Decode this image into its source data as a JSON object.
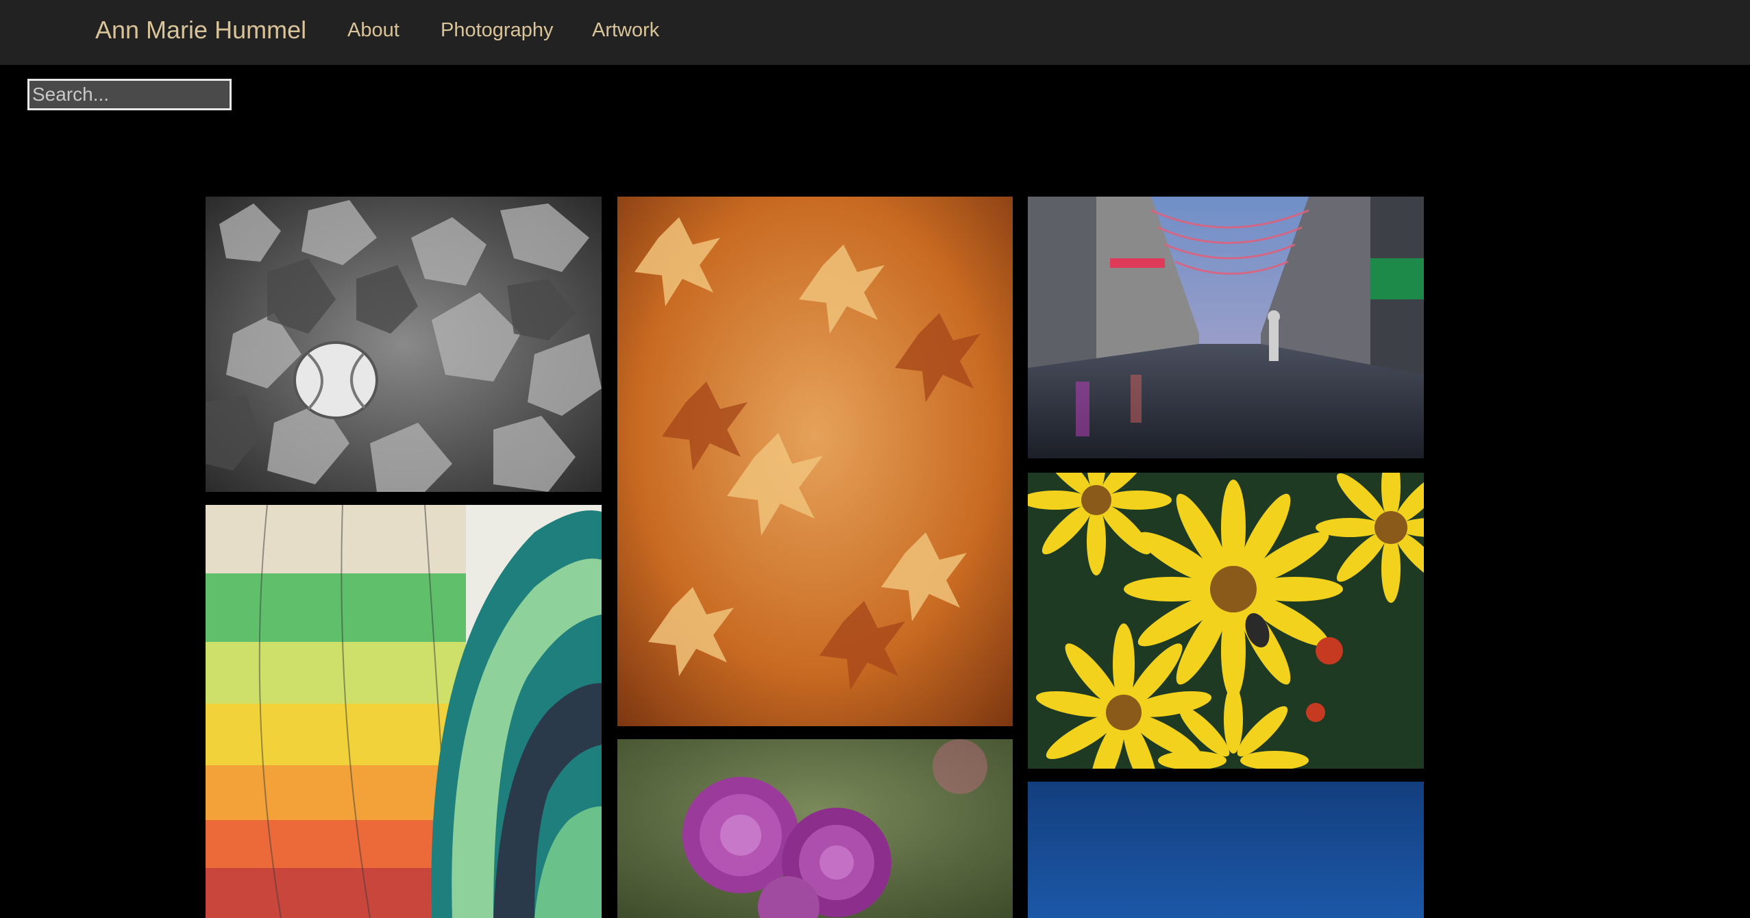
{
  "header": {
    "brand": "Ann Marie Hummel",
    "nav": [
      {
        "label": "About"
      },
      {
        "label": "Photography"
      },
      {
        "label": "Artwork"
      }
    ]
  },
  "search": {
    "placeholder": "Search..."
  },
  "gallery": {
    "photos": [
      {
        "subject": "black-and-white baseball in fallen leaves"
      },
      {
        "subject": "colorful hot air balloons"
      },
      {
        "subject": "orange autumn maple leaves"
      },
      {
        "subject": "purple chrysanthemums"
      },
      {
        "subject": "rainy city street with hanging lanterns at dusk"
      },
      {
        "subject": "yellow daisies with a bee"
      },
      {
        "subject": "blue sky"
      }
    ]
  },
  "colors": {
    "navbar_bg": "#222222",
    "link": "#d9c49a",
    "page_bg": "#000000"
  }
}
